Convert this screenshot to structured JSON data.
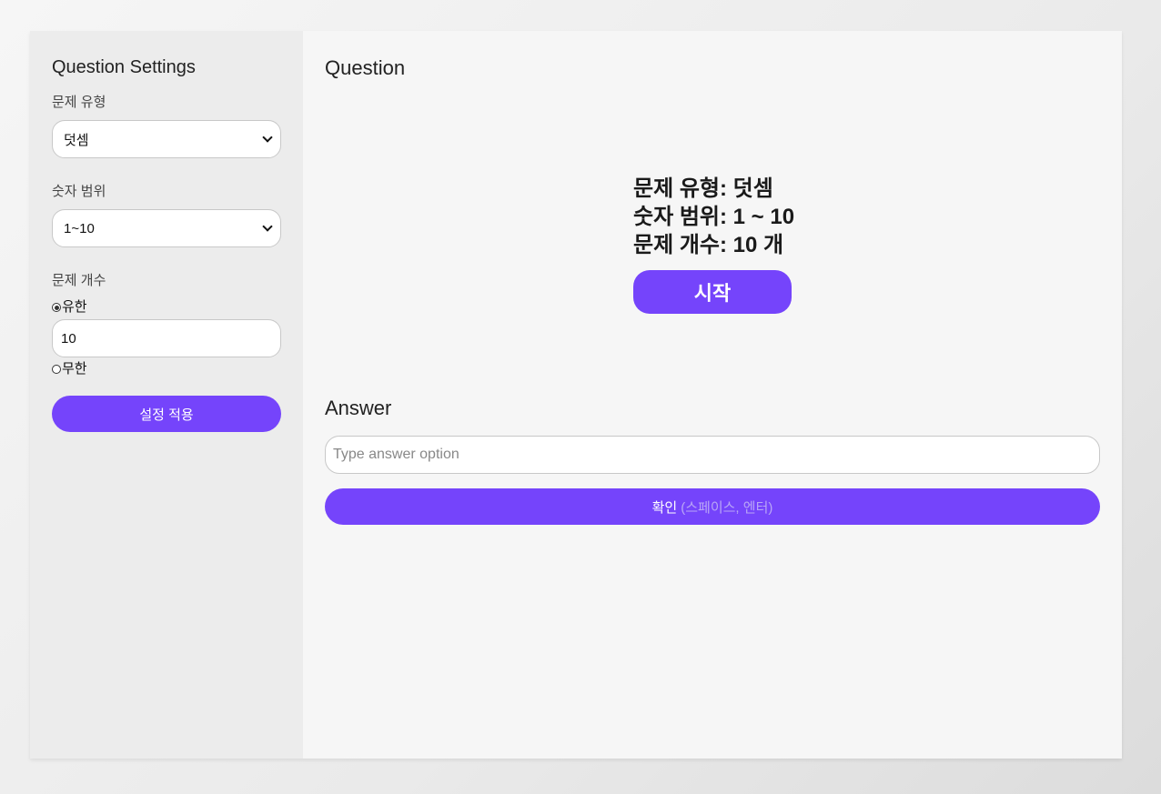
{
  "sidebar": {
    "title": "Question Settings",
    "type_label": "문제 유형",
    "type_value": "덧셈",
    "range_label": "숫자 범위",
    "range_value": "1~10",
    "count_label": "문제 개수",
    "finite_label": "유한",
    "finite_checked": true,
    "count_value": "10",
    "infinite_label": "무한",
    "apply_label": "설정 적용"
  },
  "main": {
    "question_title": "Question",
    "summary": {
      "type_line": "문제 유형: 덧셈",
      "range_line": "숫자 범위: 1 ~ 10",
      "count_line": "문제 개수: 10 개"
    },
    "start_label": "시작",
    "answer_title": "Answer",
    "answer_placeholder": "Type answer option",
    "confirm_label": "확인",
    "confirm_hint": "(스페이스, 엔터)"
  },
  "colors": {
    "accent": "#7544fb",
    "sidebar_bg": "#ececec",
    "main_bg": "#f6f6f6"
  }
}
